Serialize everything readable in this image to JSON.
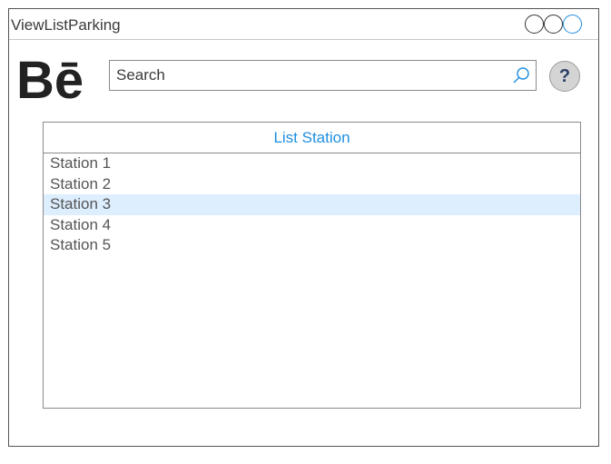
{
  "window": {
    "title": "ViewListParking",
    "controls": [
      "minimize",
      "maximize",
      "close"
    ]
  },
  "header": {
    "logo_text": "Bē",
    "search": {
      "placeholder": "Search",
      "value": "",
      "icon": "search-icon"
    },
    "help": {
      "label": "?",
      "icon": "help-icon"
    }
  },
  "list": {
    "title": "List Station",
    "items": [
      {
        "label": "Station 1",
        "selected": false
      },
      {
        "label": "Station 2",
        "selected": false
      },
      {
        "label": "Station 3",
        "selected": true
      },
      {
        "label": "Station 4",
        "selected": false
      },
      {
        "label": "Station 5",
        "selected": false
      }
    ]
  },
  "colors": {
    "accent": "#1e8fe0",
    "selected_row": "#ddeeff",
    "border": "#545454",
    "help_glyph": "#2b3d66"
  }
}
